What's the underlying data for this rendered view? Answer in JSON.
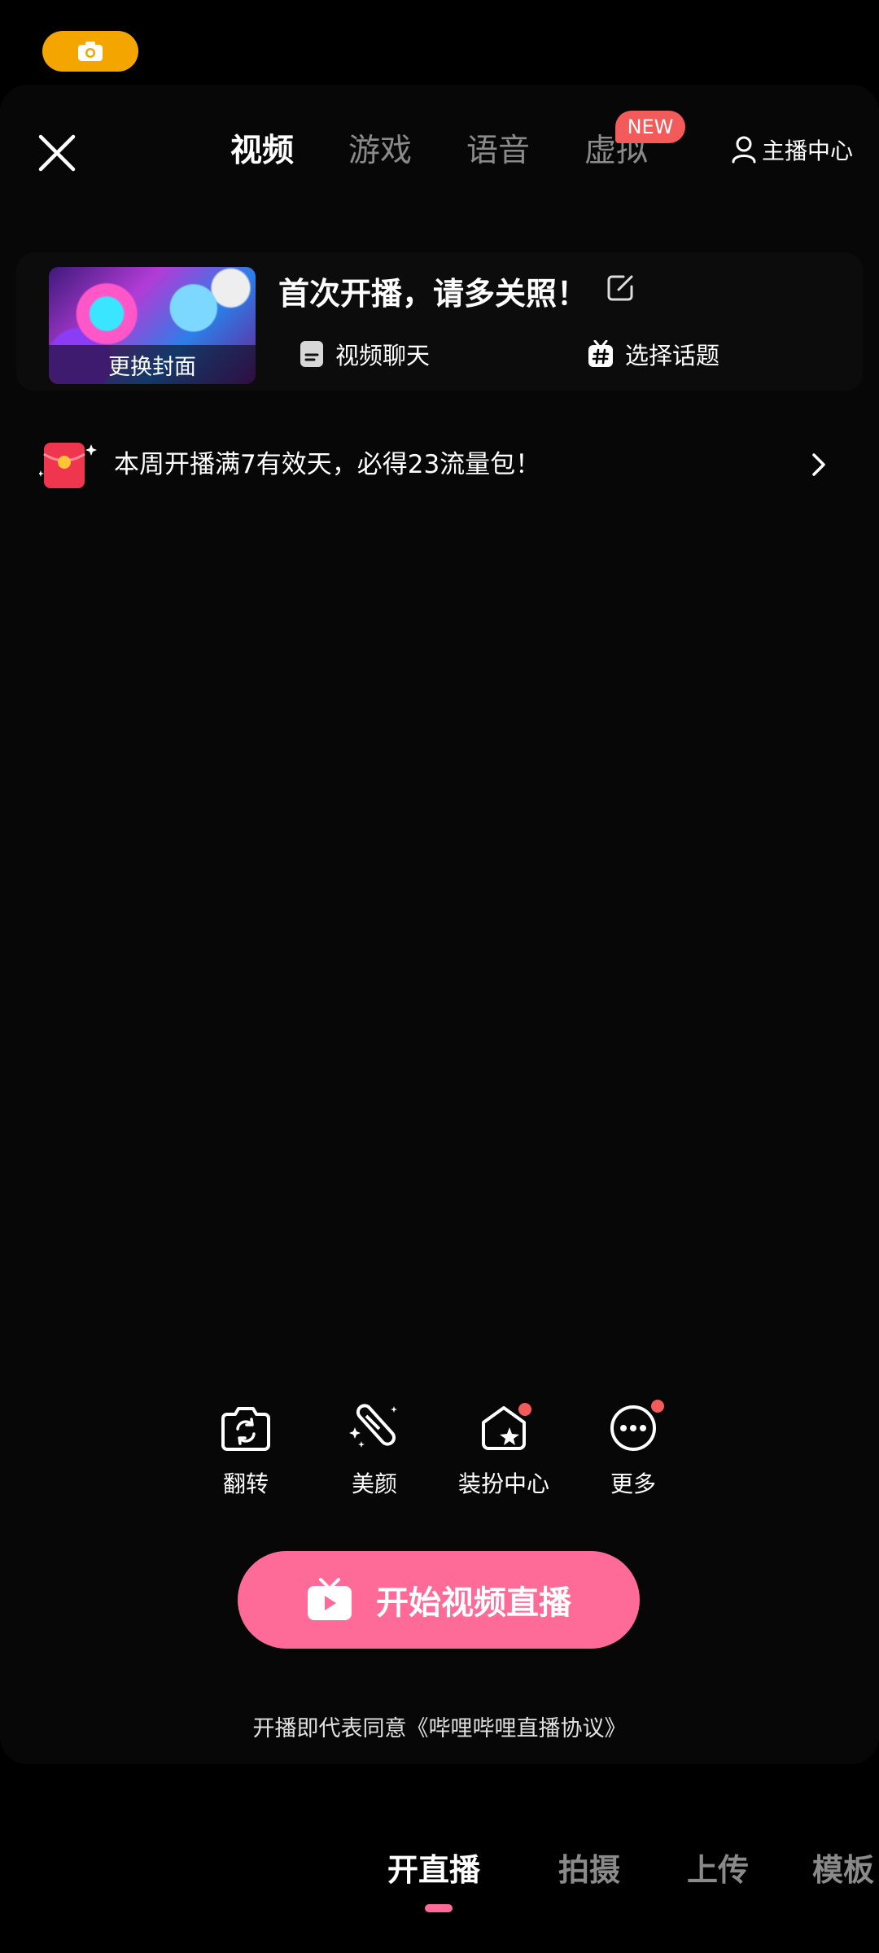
{
  "top_tabs": [
    {
      "label": "视频",
      "active": true
    },
    {
      "label": "游戏",
      "active": false
    },
    {
      "label": "语音",
      "active": false
    },
    {
      "label": "虚拟",
      "active": false
    }
  ],
  "new_badge": "NEW",
  "anchor_center_label": "主播中心",
  "cover": {
    "caption": "更换封面"
  },
  "stream_title": "首次开播，请多关照！",
  "options": {
    "video_chat": "视频聊天",
    "select_topic": "选择话题"
  },
  "promo_text": "本周开播满7有效天，必得23流量包！",
  "tools": [
    {
      "label": "翻转",
      "icon": "camera-flip-icon",
      "dot": false
    },
    {
      "label": "美颜",
      "icon": "beauty-wand-icon",
      "dot": false
    },
    {
      "label": "装扮中心",
      "icon": "dress-up-icon",
      "dot": true
    },
    {
      "label": "更多",
      "icon": "more-icon",
      "dot": true
    }
  ],
  "start_button_label": "开始视频直播",
  "agreement_text": "开播即代表同意《哔哩哔哩直播协议》",
  "bottom_modes": [
    {
      "label": "开直播",
      "active": true
    },
    {
      "label": "拍摄",
      "active": false
    },
    {
      "label": "上传",
      "active": false
    },
    {
      "label": "模板",
      "active": false
    }
  ],
  "colors": {
    "accent": "#FF6B98",
    "badge": "#F35B5B",
    "camera_pill": "#F5A500"
  }
}
